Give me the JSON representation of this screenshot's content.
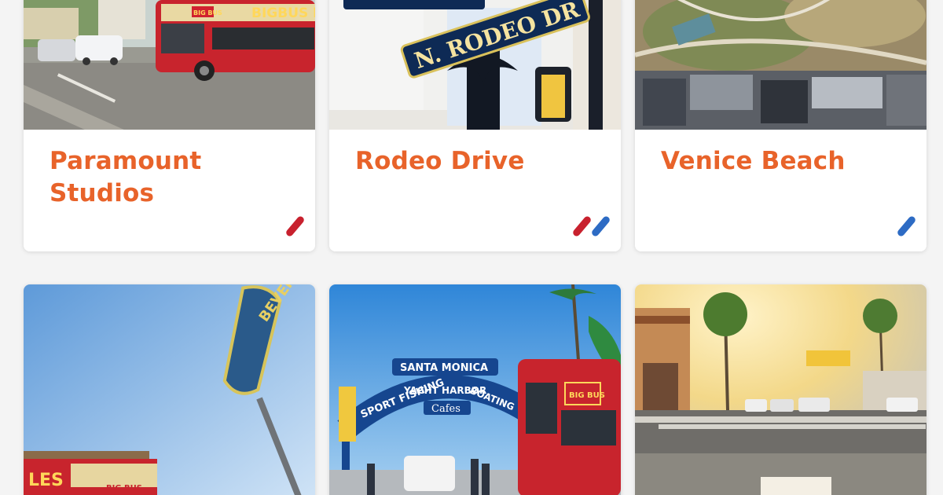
{
  "cards": [
    {
      "title_line1": "Paramount",
      "title_line2": "Studios",
      "routes": [
        "red"
      ]
    },
    {
      "title_line1": "Rodeo Drive",
      "title_line2": "",
      "routes": [
        "red",
        "blue"
      ]
    },
    {
      "title_line1": "Venice Beach",
      "title_line2": "",
      "routes": [
        "blue"
      ]
    }
  ],
  "photos": {
    "bus_sign": "BIGBUS LO",
    "bus_logo": "BIG BUS",
    "street_sign": "N. RODEO DR",
    "beverly_sign": "BEVERLY HILLS",
    "pier_top": "SANTA MONICA",
    "pier_arch": "YACHT HARBOR",
    "pier_left": "SPORT FISHING",
    "pier_right": "BOATING",
    "pier_cafe": "Cafes",
    "bus_sign_2": "LES",
    "bus_logo_2": "BIG BUS"
  },
  "colors": {
    "title": "#e8632a",
    "route_red": "#c8212e",
    "route_blue": "#2d6bc4"
  }
}
